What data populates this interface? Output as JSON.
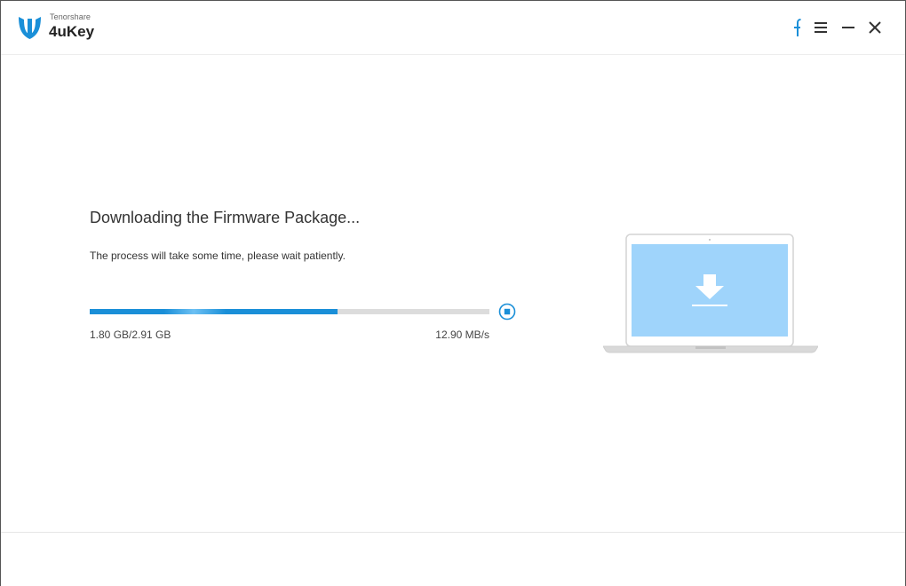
{
  "app": {
    "brand_small": "Tenorshare",
    "brand_name": "4uKey"
  },
  "titlebar": {
    "icons": [
      "facebook-icon",
      "menu-icon",
      "minimize-icon",
      "close-icon"
    ]
  },
  "download": {
    "title": "Downloading the Firmware Package...",
    "subtitle": "The process will take some time, please wait patiently.",
    "size_text": "1.80 GB/2.91 GB",
    "speed_text": "12.90 MB/s",
    "progress": 0.62
  },
  "illustration": {
    "icon": "download-icon"
  },
  "colors": {
    "accent": "#1a8fd8",
    "screen": "#9fd4fb",
    "track": "#dcdcdc"
  }
}
